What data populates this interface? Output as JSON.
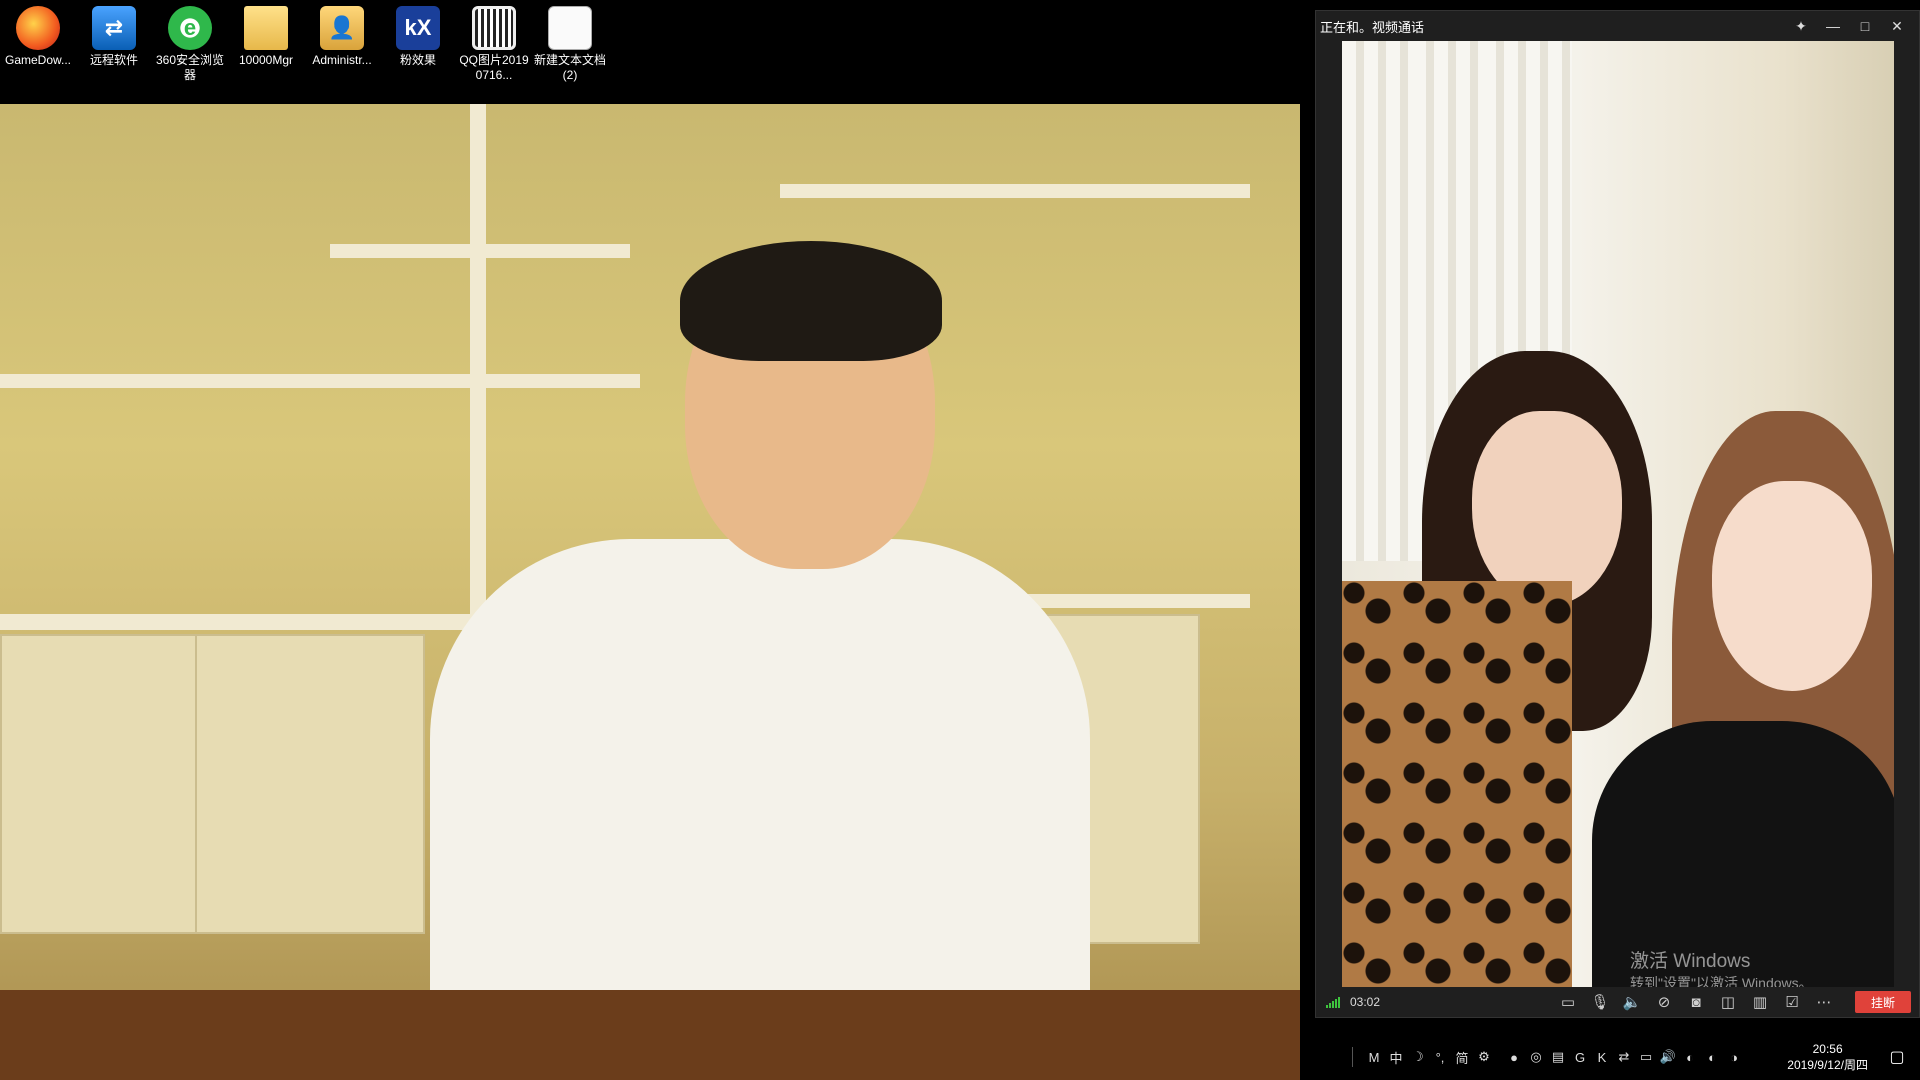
{
  "desktop": {
    "icons": [
      {
        "label": "GameDow...",
        "icon": "game-icon"
      },
      {
        "label": "远程软件",
        "icon": "remote-software-icon"
      },
      {
        "label": "360安全浏览器",
        "icon": "360-browser-icon"
      },
      {
        "label": "10000Mgr",
        "icon": "folder-icon"
      },
      {
        "label": "Administr...",
        "icon": "user-folder-icon"
      },
      {
        "label": "粉效果",
        "icon": "kx-icon"
      },
      {
        "label": "QQ图片20190716...",
        "icon": "qr-image-icon"
      },
      {
        "label": "新建文本文档(2)",
        "icon": "text-document-icon"
      }
    ]
  },
  "call_window": {
    "title": "正在和。视频通话",
    "timer": "03:02",
    "hangup_label": "挂断",
    "watermark_title": "激活 Windows",
    "watermark_sub": "转到\"设置\"以激活 Windows。",
    "controls": [
      "chat-icon",
      "microphone-icon",
      "speaker-icon",
      "camera-off-icon",
      "screenshot-icon",
      "record-icon",
      "layout-icon",
      "share-icon",
      "more-icon"
    ]
  },
  "taskbar": {
    "ime_mode": "中",
    "ime_char": "简",
    "time": "20:56",
    "date": "2019/9/12/周四"
  }
}
